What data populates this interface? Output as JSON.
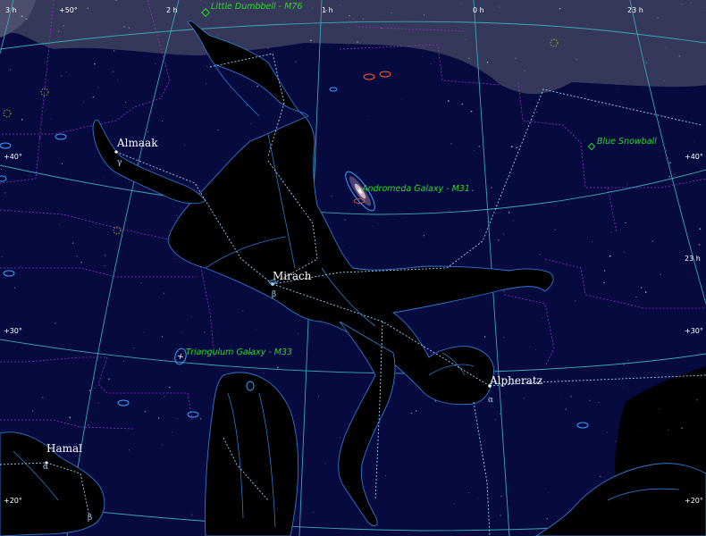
{
  "grid": {
    "ra_labels": [
      "3 h",
      "+50°",
      "2 h",
      "1 h",
      "0 h",
      "23 h"
    ],
    "dec_labels_left": [
      "+40°",
      "+30°",
      "+20°"
    ],
    "dec_labels_right": [
      "+40°",
      "23 h",
      "+30°",
      "+20°"
    ]
  },
  "stars": {
    "almaak": {
      "name": "Almaak",
      "greek": "γ"
    },
    "mirach": {
      "name": "Mirach",
      "greek": "β"
    },
    "alpheratz": {
      "name": "Alpheratz",
      "greek": "α"
    },
    "hamal": {
      "name": "Hamal",
      "greek": "α",
      "greek2": "β"
    }
  },
  "deep_sky": {
    "little_dumbbell": "Little Dumbbell - M76",
    "blue_snowball": "Blue Snowball",
    "andromeda": "Andromeda Galaxy - M31",
    "triangulum": "Triangulum Galaxy - M33"
  },
  "colors": {
    "sky": "#060a3e",
    "grid": "#3aa8b8",
    "boundary": "#9a2cd0",
    "dso_label": "#2bd82b",
    "art_stroke": "#2f78d0"
  }
}
